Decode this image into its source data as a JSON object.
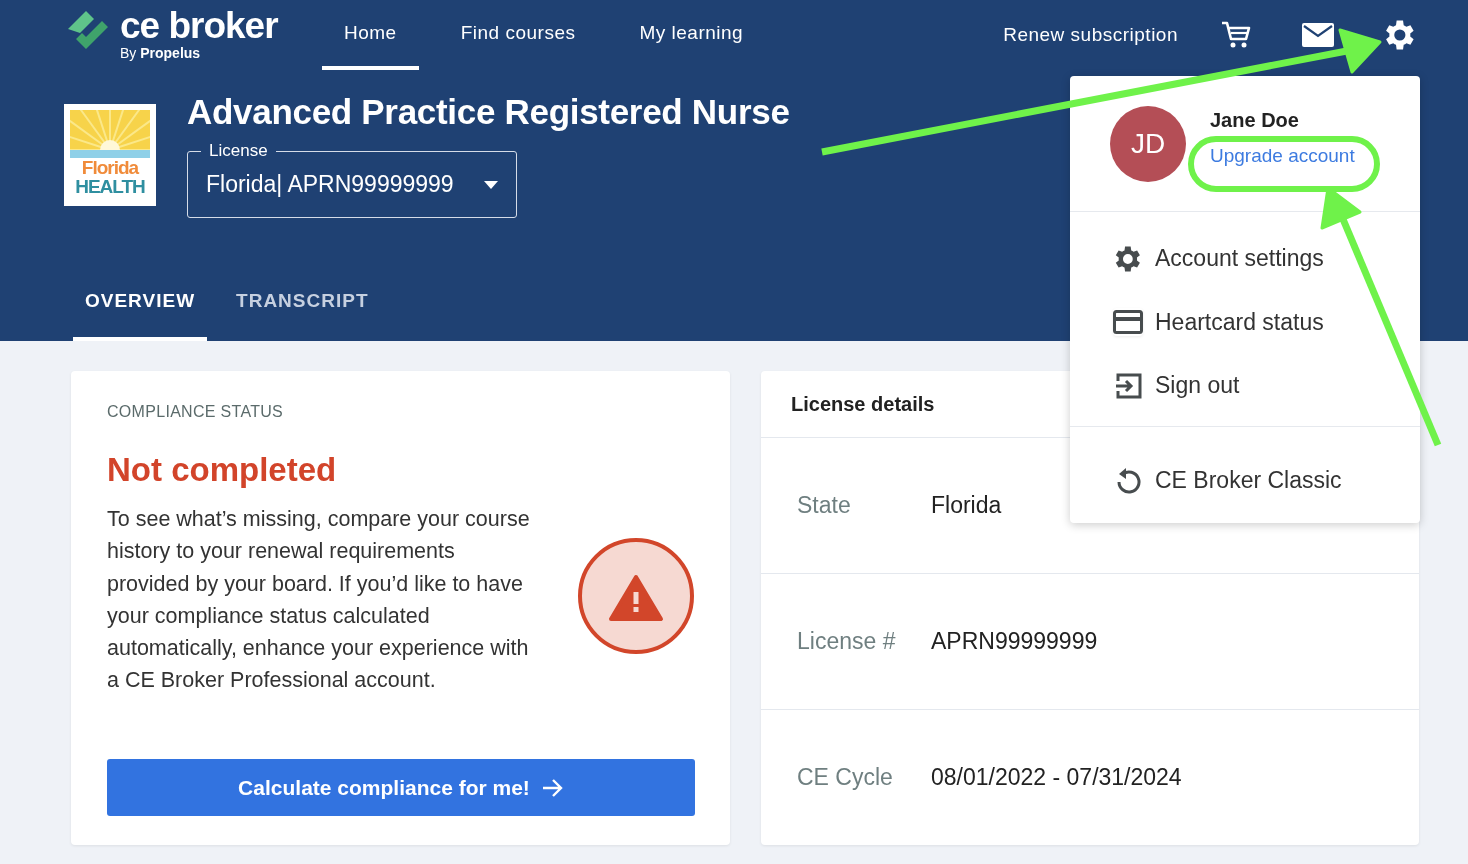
{
  "brand": {
    "name": "ce broker",
    "byline_prefix": "By",
    "byline_company": "Propelus"
  },
  "nav": [
    {
      "label": "Home",
      "selected": true
    },
    {
      "label": "Find courses",
      "selected": false
    },
    {
      "label": "My learning",
      "selected": false
    }
  ],
  "header_actions": {
    "renew": "Renew subscription"
  },
  "board_logo": {
    "line1": "Florida",
    "line2": "HEALTH"
  },
  "profession": "Advanced Practice Registered Nurse",
  "license_select": {
    "label": "License",
    "value": "Florida| APRN99999999"
  },
  "tabs": [
    {
      "label": "OVERVIEW",
      "selected": true
    },
    {
      "label": "TRANSCRIPT",
      "selected": false
    }
  ],
  "compliance": {
    "heading": "COMPLIANCE STATUS",
    "status": "Not completed",
    "text": "To see what’s missing, compare your course history to your renewal requirements provided by your board. If you’d like to have your compliance status calculated automatically, enhance your experience with a CE Broker Professional account.",
    "button": "Calculate compliance for me!"
  },
  "license_details": {
    "title": "License details",
    "rows": [
      {
        "label": "State",
        "value": "Florida"
      },
      {
        "label": "License #",
        "value": "APRN99999999"
      },
      {
        "label": "CE Cycle",
        "value": "08/01/2022 - 07/31/2024"
      }
    ]
  },
  "user_menu": {
    "initials": "JD",
    "name": "Jane Doe",
    "link": "Upgrade account",
    "items": [
      {
        "kind": "gear",
        "label": "Account settings"
      },
      {
        "kind": "card",
        "label": "Heartcard status"
      },
      {
        "kind": "signout",
        "label": "Sign out"
      },
      {
        "kind": "classic",
        "label": "CE Broker Classic"
      }
    ]
  },
  "annotations": [
    {
      "kind": "arrow"
    },
    {
      "kind": "arrow"
    },
    {
      "kind": "highlight"
    }
  ]
}
